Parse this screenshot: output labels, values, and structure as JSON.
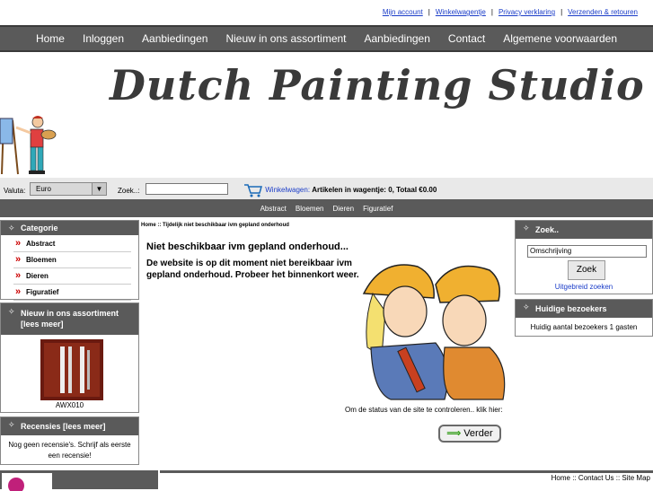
{
  "top_links": [
    "Mijn account",
    "Winkelwagentje",
    "Privacy verklaring",
    "Verzenden & retouren"
  ],
  "top_sep": "|",
  "main_nav": [
    "Home",
    "Inloggen",
    "Aanbiedingen",
    "Nieuw in ons assortiment",
    "Aanbiedingen",
    "Contact",
    "Algemene voorwaarden"
  ],
  "logo_text": "Dutch Painting Studio",
  "toolbar": {
    "valuta_label": "Valuta:",
    "valuta_value": "Euro",
    "search_label": "Zoek..:",
    "cart_link": "Winkelwagen:",
    "cart_text": "Artikelen in wagentje: 0, Totaal €0.00"
  },
  "sub_nav": [
    "Abstract",
    "Bloemen",
    "Dieren",
    "Figuratief"
  ],
  "left": {
    "categorie_title": "Categorie",
    "categories": [
      "Abstract",
      "Bloemen",
      "Dieren",
      "Figuratief"
    ],
    "nieuw_title": "Nieuw in ons assortiment  [lees meer]",
    "product_code": "AWX010",
    "recensies_title": "Recensies  [lees meer]",
    "recensies_text": "Nog geen recensie's. Schrijf als eerste een recensie!"
  },
  "breadcrumb": "Home :: Tijdelijk niet beschikbaar ivm gepland onderhoud",
  "content": {
    "heading": "Niet beschikbaar ivm gepland onderhoud...",
    "body": "De website is op dit moment niet bereikbaar ivm gepland onderhoud. Probeer het binnenkort weer.",
    "status_text": "Om de status van de site te controleren.. klik hier:",
    "verder_label": "Verder"
  },
  "right": {
    "zoek_title": "Zoek..",
    "search_value": "Omschrijving",
    "zoek_button": "Zoek",
    "advanced_link": "Uitgebreid zoeken",
    "bezoekers_title": "Huidige bezoekers",
    "bezoekers_text": "Huidig aantal bezoekers 1 gasten"
  },
  "footer_links": [
    "Home",
    "Contact Us",
    "Site Map"
  ],
  "footer_sep": "::",
  "colors": {
    "nav_bg": "#5a5a5a",
    "link": "#1a3cc8",
    "accent": "#cc0000"
  }
}
